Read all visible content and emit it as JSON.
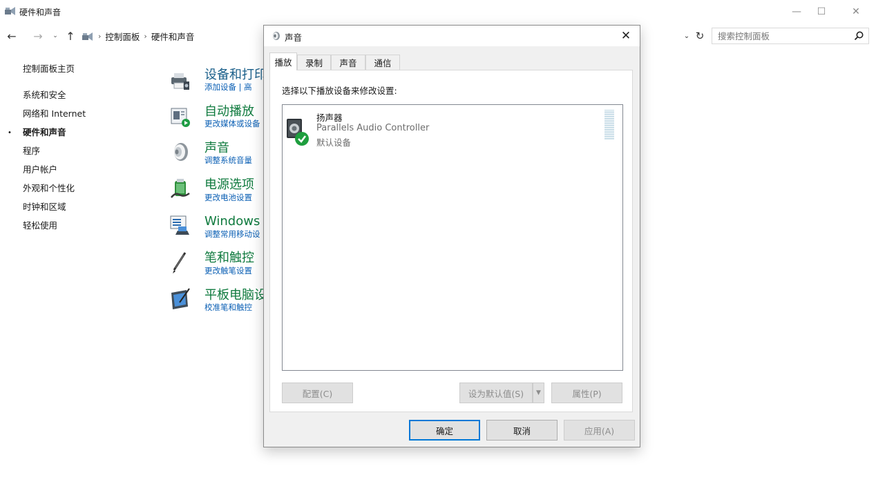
{
  "window": {
    "title": "硬件和声音",
    "min_glyph": "—",
    "max_glyph": "☐",
    "close_glyph": "✕"
  },
  "nav": {
    "back": "←",
    "forward": "→",
    "recent": "⌄",
    "up": "↑",
    "breadcrumb": [
      "控制面板",
      "硬件和声音"
    ],
    "separator": "›",
    "dropdown": "⌄",
    "refresh": "↻",
    "search_placeholder": "搜索控制面板"
  },
  "sidebar": {
    "items": [
      {
        "label": "控制面板主页"
      },
      {
        "label": "系统和安全"
      },
      {
        "label": "网络和 Internet"
      },
      {
        "label": "硬件和声音",
        "active": true
      },
      {
        "label": "程序"
      },
      {
        "label": "用户帐户"
      },
      {
        "label": "外观和个性化"
      },
      {
        "label": "时钟和区域"
      },
      {
        "label": "轻松使用"
      }
    ],
    "bullet": "•"
  },
  "categories": [
    {
      "title": "设备和打印",
      "sub": "添加设备  |  高",
      "icon": "printer-icon"
    },
    {
      "title": "自动播放",
      "sub": "更改媒体或设备",
      "icon": "autoplay-icon"
    },
    {
      "title": "声音",
      "sub": "调整系统音量",
      "icon": "speaker-icon"
    },
    {
      "title": "电源选项",
      "sub": "更改电池设置",
      "icon": "power-icon"
    },
    {
      "title": "Windows 移",
      "sub": "调整常用移动设",
      "icon": "mobility-icon"
    },
    {
      "title": "笔和触控",
      "sub": "更改触笔设置",
      "icon": "pen-icon"
    },
    {
      "title": "平板电脑设",
      "sub": "校准笔和触控",
      "icon": "tablet-icon"
    }
  ],
  "dialog": {
    "title": "声音",
    "close_glyph": "✕",
    "tabs": [
      "播放",
      "录制",
      "声音",
      "通信"
    ],
    "instruction": "选择以下播放设备来修改设置:",
    "device": {
      "name": "扬声器",
      "description": "Parallels Audio Controller",
      "status": "默认设备",
      "level": 0
    },
    "buttons": {
      "configure": "配置(C)",
      "set_default": "设为默认值(S)",
      "dropdown": "▼",
      "properties": "属性(P)",
      "ok": "确定",
      "cancel": "取消",
      "apply": "应用(A)"
    },
    "colors": {
      "accent": "#0078d7",
      "check": "#1e9e3e"
    }
  }
}
